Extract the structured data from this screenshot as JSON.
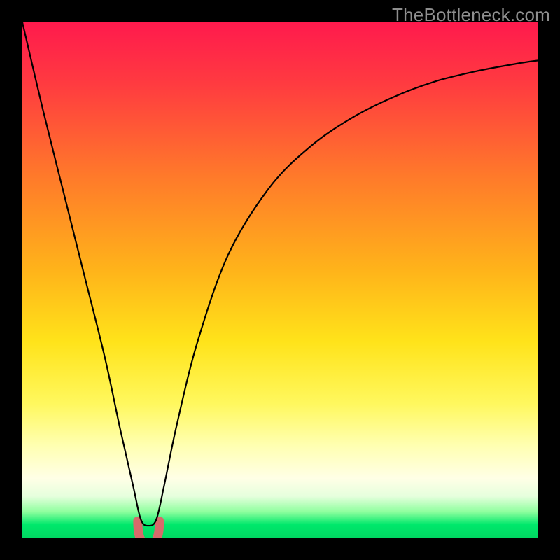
{
  "watermark": {
    "text": "TheBottleneck.com"
  },
  "chart_data": {
    "type": "line",
    "title": "",
    "xlabel": "",
    "ylabel": "",
    "xlim": [
      0,
      100
    ],
    "ylim": [
      0,
      100
    ],
    "grid": false,
    "legend": false,
    "background_gradient": {
      "stops": [
        {
          "offset": 0.0,
          "color": "#ff1a4d"
        },
        {
          "offset": 0.12,
          "color": "#ff3b40"
        },
        {
          "offset": 0.3,
          "color": "#ff7a2a"
        },
        {
          "offset": 0.48,
          "color": "#ffb31a"
        },
        {
          "offset": 0.62,
          "color": "#ffe31a"
        },
        {
          "offset": 0.74,
          "color": "#fff85e"
        },
        {
          "offset": 0.82,
          "color": "#ffffb0"
        },
        {
          "offset": 0.885,
          "color": "#ffffe6"
        },
        {
          "offset": 0.92,
          "color": "#e6ffdd"
        },
        {
          "offset": 0.95,
          "color": "#8eff9e"
        },
        {
          "offset": 0.975,
          "color": "#00e86b"
        },
        {
          "offset": 1.0,
          "color": "#00d862"
        }
      ]
    },
    "series": [
      {
        "name": "bottleneck-curve",
        "color": "#000000",
        "x": [
          0,
          4,
          8,
          12,
          16,
          19,
          21.5,
          23.0,
          24.5,
          26.0,
          27.5,
          30,
          34,
          40,
          48,
          56,
          64,
          72,
          80,
          88,
          96,
          100
        ],
        "y": [
          100,
          83,
          67,
          51,
          35,
          21,
          10,
          3.5,
          2.3,
          3.5,
          10,
          22,
          38,
          55,
          68,
          76,
          81.5,
          85.5,
          88.5,
          90.5,
          92,
          92.6
        ]
      }
    ],
    "min_marker": {
      "x_range": [
        22.4,
        26.6
      ],
      "y_level": 2.8,
      "depth": 4.0,
      "color": "#d66b6b"
    }
  }
}
